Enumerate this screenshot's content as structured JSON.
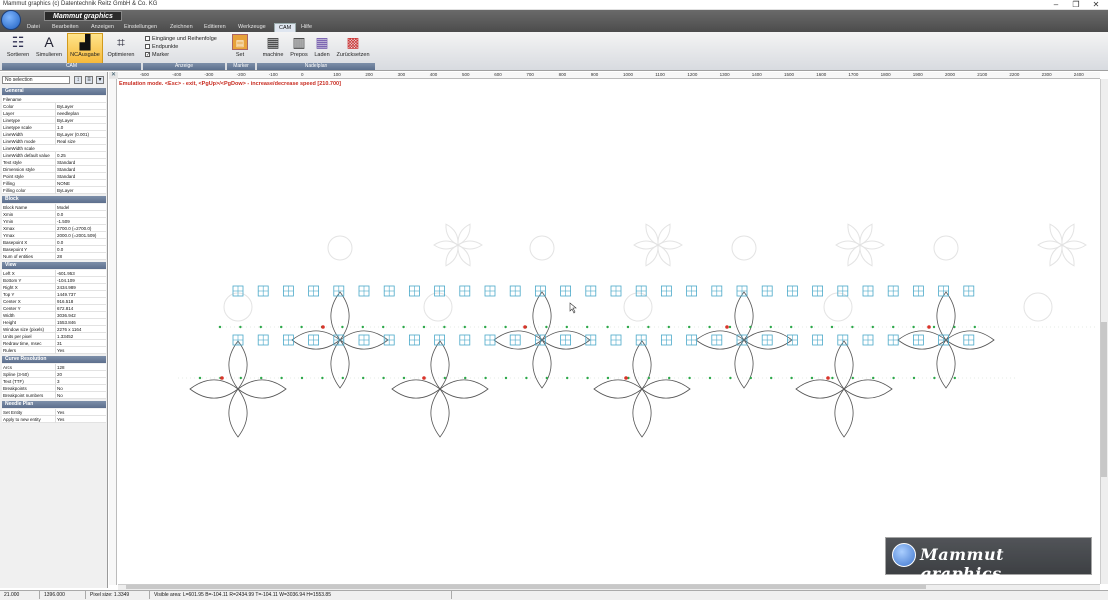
{
  "window": {
    "title": "Mammut graphics (c) Datentechnik Reitz GmbH & Co. KG",
    "controls": [
      "–",
      "❐",
      "✕"
    ]
  },
  "brand": {
    "small_logo": "Mammut graphics",
    "watermark": "Mammut graphics"
  },
  "ribbon": {
    "tabs": [
      "Datei",
      "Bearbeiten",
      "Anzeigen",
      "Einstellungen",
      "Zeichnen",
      "Editieren",
      "Werkzeuge",
      "CAM",
      "Hilfe"
    ],
    "active_tab": "CAM",
    "buttons": {
      "sortieren": "Sortieren",
      "simulieren": "Simulieren",
      "ncausgabe": "NCAusgabe",
      "optimieren": "Optimieren",
      "set": "Set",
      "machine": "machine",
      "prepos": "Prepos",
      "laden": "Laden",
      "zuruecksetzen": "Zurücksetzen"
    },
    "checkboxes": [
      {
        "label": "Eingänge und Reihenfolge",
        "checked": false
      },
      {
        "label": "Endpunkte",
        "checked": false
      },
      {
        "label": "Marker",
        "checked": true
      }
    ],
    "groups": {
      "cam": "CAM",
      "anzeige": "Anzeige",
      "marker": "Marker",
      "nadelplan": "Nadelplan"
    }
  },
  "panel": {
    "selection": "No selection",
    "general": {
      "title": "General",
      "rows": [
        [
          "Filename",
          ""
        ],
        [
          "Color",
          "ByLayer"
        ],
        [
          "Layer",
          "needleplan"
        ],
        [
          "Linetype",
          "ByLayer"
        ],
        [
          "Linetype scale",
          "1.0"
        ],
        [
          "LineWidth",
          "ByLayer (0.001)"
        ],
        [
          "LineWidth mode",
          "Real size"
        ],
        [
          "LineWidth scale",
          ""
        ],
        [
          "LineWidth default value",
          "0.25"
        ],
        [
          "Text style",
          "Standard"
        ],
        [
          "Dimension style",
          "Standard"
        ],
        [
          "Point style",
          "Standard"
        ],
        [
          "Filling",
          "NONE"
        ],
        [
          "Filling color",
          "ByLayer"
        ]
      ]
    },
    "block": {
      "title": "Block",
      "rows": [
        [
          "Block Name",
          "Model"
        ],
        [
          "Xmin",
          "0.0"
        ],
        [
          "Ymin",
          "-1.509"
        ],
        [
          "Xmax",
          "2700.0  (=2700.0)"
        ],
        [
          "Ymax",
          "2000.0  (=2001.509)"
        ],
        [
          "Basepoint X",
          "0.0"
        ],
        [
          "Basepoint Y",
          "0.0"
        ],
        [
          "Num of entities",
          "28"
        ]
      ]
    },
    "view": {
      "title": "View",
      "rows": [
        [
          "Left X",
          "-601.953"
        ],
        [
          "Bottom Y",
          "-104.109"
        ],
        [
          "Right X",
          "2434.989"
        ],
        [
          "Top Y",
          "1449.737"
        ],
        [
          "Center X",
          "916.518"
        ],
        [
          "Center Y",
          "672.814"
        ],
        [
          "Width",
          "3036.942"
        ],
        [
          "Height",
          "1553.846"
        ],
        [
          "Window size (pixels)",
          "2276 x 1164"
        ],
        [
          "Units per pixel",
          "1.33452"
        ],
        [
          "Redraw time, msec",
          "31"
        ],
        [
          "Rulers",
          "Yes"
        ]
      ]
    },
    "curve": {
      "title": "Curve Resolution",
      "rows": [
        [
          "Arcs",
          "128"
        ],
        [
          "Spline (3-50)",
          "20"
        ],
        [
          "Text (TTF)",
          "3"
        ],
        [
          "Breakpoints",
          "No"
        ],
        [
          "Breakpoint numbers",
          "No"
        ]
      ]
    },
    "needle": {
      "title": "Needle Plan",
      "rows": [
        [
          "Set Entity",
          "Yes"
        ],
        [
          "Apply to new entity",
          "Yes"
        ]
      ]
    }
  },
  "rulers": {
    "top": [
      "-500",
      "-400",
      "-300",
      "-200",
      "-100",
      "0",
      "100",
      "200",
      "300",
      "400",
      "500",
      "600",
      "700",
      "800",
      "900",
      "1000",
      "1100",
      "1200",
      "1300",
      "1400",
      "1500",
      "1600",
      "1700",
      "1800",
      "1900",
      "2000",
      "2100",
      "2200",
      "2300",
      "2400"
    ]
  },
  "canvas": {
    "emulation_text": "Emulation mode. <Esc> - exit, <PgUp>/<PgDow> - increase/decrease speed [210.700]"
  },
  "status": {
    "cells": [
      "21.000",
      "1396.000",
      "Pixel size: 1.3349",
      "Visible area:  L=601.95  B=-104.11  R=2434.99  T=-104.11  W=3036.94  H=1553.85"
    ]
  },
  "colors": {
    "grid_marker": "#4aa8c9",
    "dot_green": "#2da84a",
    "dot_red": "#d9342b",
    "shape_stroke": "#555555",
    "ghost": "#e3e3e3"
  }
}
